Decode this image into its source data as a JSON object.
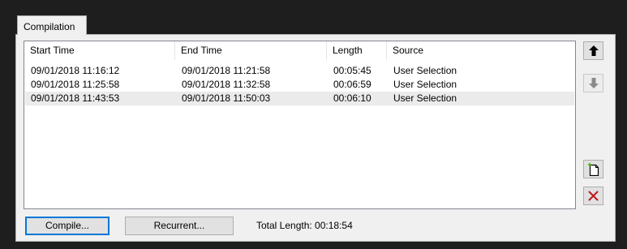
{
  "tab": {
    "label": "Compilation"
  },
  "table": {
    "columns": [
      "Start Time",
      "End Time",
      "Length",
      "Source"
    ],
    "rows": [
      [
        "09/01/2018 11:16:12",
        "09/01/2018 11:21:58",
        "00:05:45",
        "User Selection"
      ],
      [
        "09/01/2018 11:25:58",
        "09/01/2018 11:32:58",
        "00:06:59",
        "User Selection"
      ],
      [
        "09/01/2018 11:43:53",
        "09/01/2018 11:50:03",
        "00:06:10",
        "User Selection"
      ]
    ],
    "selected_row": 3
  },
  "side_buttons": {
    "move_up": {
      "icon": "arrow-up-icon",
      "enabled": true
    },
    "move_down": {
      "icon": "arrow-down-icon",
      "enabled": false
    },
    "new": {
      "icon": "new-document-icon",
      "enabled": true
    },
    "delete": {
      "icon": "delete-x-icon",
      "enabled": true
    }
  },
  "buttons": {
    "compile_label": "Compile...",
    "recurrent_label": "Recurrent..."
  },
  "total_length": "Total Length: 00:18:54",
  "colors": {
    "delete_red": "#c0181d",
    "selected_row_bg": "#ebebeb",
    "accent_border": "#0078d7",
    "new_star_green": "#4ab000"
  }
}
